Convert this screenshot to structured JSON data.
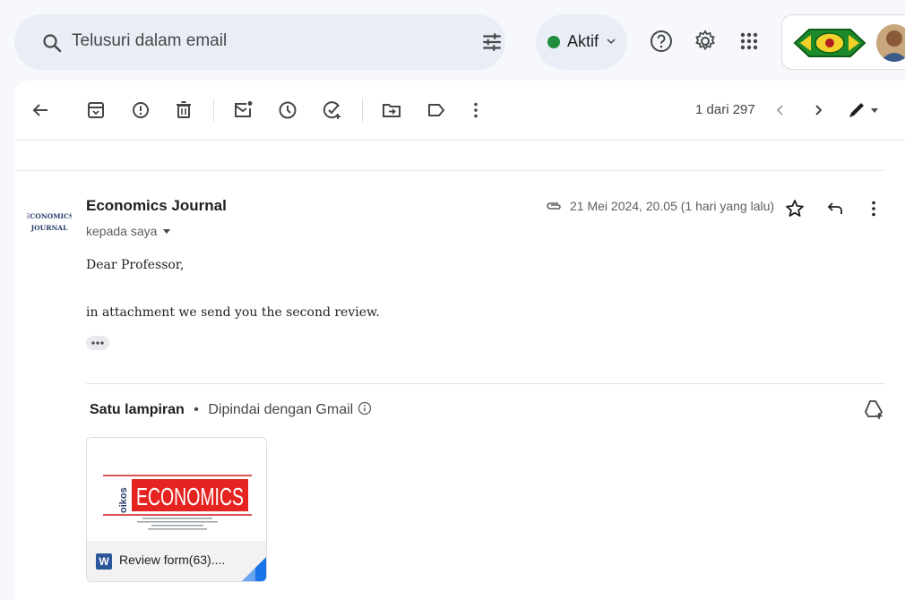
{
  "search": {
    "placeholder": "Telusuri dalam email"
  },
  "status": {
    "label": "Aktif",
    "color": "#1e8e3e"
  },
  "pager": {
    "text": "1 dari 297"
  },
  "email": {
    "sender": "Economics Journal",
    "sender_logo_line1": "ECONOMICS",
    "sender_logo_line2": "JOURNAL",
    "to": "kepada saya",
    "date": "21 Mei 2024, 20.05 (1 hari yang lalu)",
    "greeting": "Dear Professor,",
    "message": "in attachment we send you the second review."
  },
  "attachments": {
    "title": "Satu lampiran",
    "separator": "•",
    "scan_text": "Dipindai dengan Gmail",
    "file_name": "Review form(63)....",
    "file_type_letter": "W",
    "preview_brand": "ECONOMICS",
    "preview_side": "oikos"
  },
  "icons": {
    "search": "search-icon",
    "filter": "tune-icon",
    "help": "help-icon",
    "settings": "gear-icon",
    "apps": "apps-grid-icon",
    "back": "arrow-back-icon",
    "archive": "archive-icon",
    "spam": "report-spam-icon",
    "delete": "trash-icon",
    "unread": "mark-unread-icon",
    "snooze": "snooze-clock-icon",
    "add_task": "add-task-icon",
    "move": "move-to-folder-icon",
    "label": "label-icon",
    "more": "more-vert-icon",
    "star": "star-icon",
    "reply": "reply-icon",
    "attachment": "paperclip-icon",
    "drive": "add-to-drive-icon"
  }
}
